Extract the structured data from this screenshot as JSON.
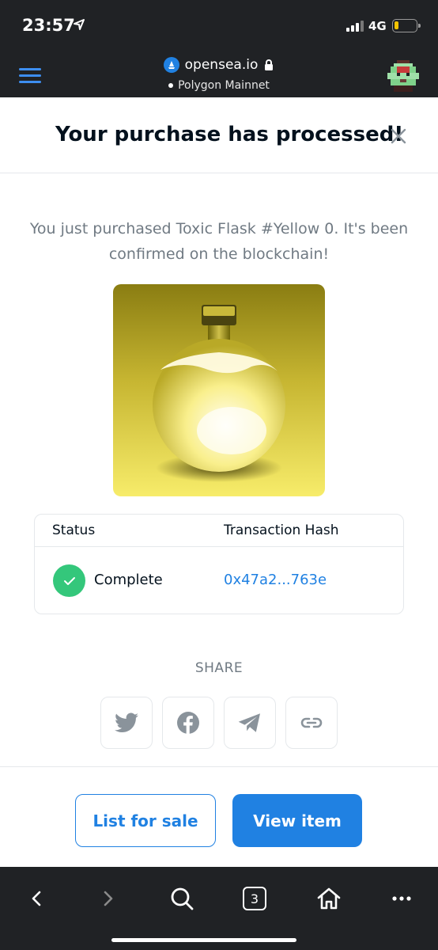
{
  "status_bar": {
    "time": "23:57",
    "network": "4G"
  },
  "browser": {
    "url": "opensea.io",
    "network_name": "Polygon Mainnet"
  },
  "modal": {
    "title": "Your purchase has processed!",
    "message": "You just purchased Toxic Flask #Yellow 0. It's been confirmed on the blockchain!",
    "table": {
      "status_header": "Status",
      "hash_header": "Transaction Hash",
      "status_value": "Complete",
      "hash_value": "0x47a2...763e"
    },
    "share_label": "SHARE",
    "share_icons": [
      "twitter-icon",
      "facebook-icon",
      "telegram-icon",
      "link-icon"
    ],
    "list_button": "List for sale",
    "view_button": "View item"
  },
  "bottom_bar": {
    "tab_count": "3"
  },
  "colors": {
    "accent": "#2081e2",
    "success": "#34c77b",
    "dark_bar": "#202225",
    "text_primary": "#04111d",
    "text_secondary": "#707a83",
    "nft_yellow": "#f5e86a"
  }
}
